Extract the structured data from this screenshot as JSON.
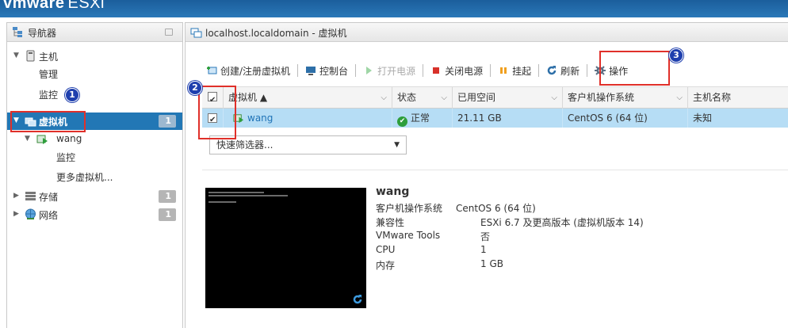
{
  "header": {
    "brand": "vmware",
    "product": "ESXi"
  },
  "navigator": {
    "title": "导航器",
    "host": {
      "label": "主机",
      "children": [
        "管理",
        "监控"
      ]
    },
    "vms": {
      "label": "虚拟机",
      "count": "1",
      "vm_name": "wang",
      "vm_children": [
        "监控",
        "更多虚拟机..."
      ]
    },
    "storage": {
      "label": "存储",
      "count": "1"
    },
    "network": {
      "label": "网络",
      "count": "1"
    }
  },
  "main": {
    "title": "localhost.localdomain - 虚拟机",
    "toolbar": {
      "create": "创建/注册虚拟机",
      "console": "控制台",
      "power_on": "打开电源",
      "power_off": "关闭电源",
      "suspend": "挂起",
      "refresh": "刷新",
      "actions": "操作"
    },
    "grid": {
      "columns": [
        "虚拟机 ▲",
        "状态",
        "已用空间",
        "客户机操作系统",
        "主机名称"
      ],
      "rows": [
        {
          "name": "wang",
          "status": "正常",
          "used": "21.11 GB",
          "os": "CentOS 6 (64 位)",
          "host": "未知"
        }
      ]
    },
    "filter": {
      "label": "快速筛选器..."
    },
    "details": {
      "vm_name": "wang",
      "rows": [
        {
          "key": "客户机操作系统",
          "value": "CentOS 6 (64 位)"
        },
        {
          "key": "兼容性",
          "value": "ESXi 6.7 及更高版本 (虚拟机版本 14)"
        },
        {
          "key": "VMware Tools",
          "value": "否"
        },
        {
          "key": "CPU",
          "value": "1"
        },
        {
          "key": "内存",
          "value": "1 GB"
        }
      ]
    }
  },
  "annotations": [
    "1",
    "2",
    "3"
  ],
  "colors": {
    "accent": "#2277b5",
    "annotation_box": "#e0302a",
    "annotation_badge": "#1e3fae",
    "row_selected": "#b6ddf5"
  }
}
